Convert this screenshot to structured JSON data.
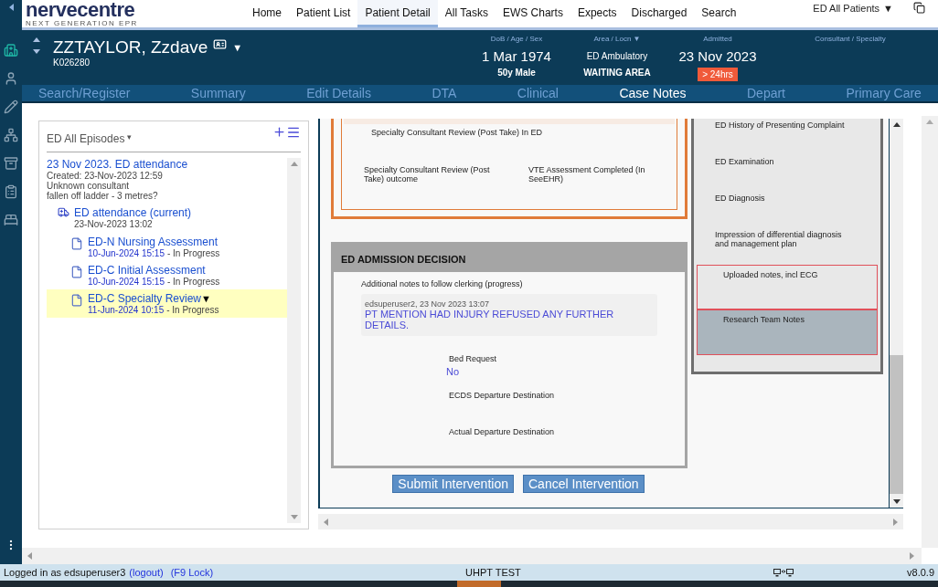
{
  "sidebar": {
    "items": [
      {
        "selected": true
      },
      {
        "selected": false
      },
      {
        "selected": false
      },
      {
        "selected": false
      },
      {
        "selected": false
      },
      {
        "selected": false
      },
      {
        "selected": false
      }
    ]
  },
  "logo": {
    "name": "nervecentre",
    "tagline": "NEXT GENERATION EPR"
  },
  "nav": [
    {
      "label": "Home",
      "selected": false
    },
    {
      "label": "Patient List",
      "selected": false
    },
    {
      "label": "Patient Detail",
      "selected": true
    },
    {
      "label": "All Tasks",
      "selected": false
    },
    {
      "label": "EWS Charts",
      "selected": false
    },
    {
      "label": "Expects",
      "selected": false
    },
    {
      "label": "Discharged",
      "selected": false
    },
    {
      "label": "Search",
      "selected": false
    }
  ],
  "patient_filter": {
    "label": "ED All Patients",
    "caret": "▼"
  },
  "patient": {
    "name": "ZZTAYLOR, Zzdave",
    "caret": "▼",
    "number": "K026280",
    "fields": [
      {
        "label": "DoB / Age / Sex",
        "value": "1 Mar 1974",
        "subvalue": "50y Male"
      },
      {
        "label": "Area / Locn",
        "caret": "▼",
        "value": "ED Ambulatory",
        "subvalue": "WAITING AREA"
      },
      {
        "label": "Admitted",
        "value": "23 Nov 2023",
        "badge": "> 24hrs"
      },
      {
        "label": "Consultant / Specialty"
      }
    ]
  },
  "tabs": [
    {
      "label": "Search/Register",
      "selected": false
    },
    {
      "label": "Summary",
      "selected": false
    },
    {
      "label": "Edit Details",
      "selected": false
    },
    {
      "label": "DTA",
      "selected": false
    },
    {
      "label": "Clinical",
      "selected": false
    },
    {
      "label": "Case Notes",
      "selected": true
    },
    {
      "label": "Depart",
      "selected": false
    },
    {
      "label": "Primary Care",
      "selected": false
    }
  ],
  "episodes": {
    "title": "ED All Episodes",
    "caret": "▾",
    "episode": {
      "title": "23 Nov 2023. ED attendance",
      "lines": [
        "Created: 23-Nov-2023 12:59",
        "Unknown consultant",
        "fallen off ladder - 3 metres?"
      ],
      "attendance": {
        "title": "ED attendance (current)",
        "date": "23-Nov-2023 13:02",
        "documents": [
          {
            "title": "ED-N Nursing Assessment",
            "date": "10-Jun-2024 15:15",
            "status": "- In Progress",
            "selected": false
          },
          {
            "title": "ED-C Initial Assessment",
            "date": "10-Jun-2024 15:15",
            "status": "- In Progress",
            "selected": false
          },
          {
            "title": "ED-C Specialty Review",
            "caret": "▼",
            "date": "11-Jun-2024 10:15",
            "status": "- In Progress",
            "selected": true
          }
        ]
      }
    }
  },
  "form": {
    "specialty_section": {
      "title": "Specialty Consultant Review (Post Take) In ED",
      "fields": [
        "Specialty Consultant Review (Post Take) outcome",
        "VTE Assessment Completed (In SeeEHR)"
      ]
    },
    "admission_decision": {
      "title": "ED ADMISSION DECISION",
      "notes_label": "Additional notes to follow clerking (progress)",
      "note": {
        "author": "edsuperuser2, 23 Nov 2023 13:07",
        "text": "PT MENTION HAD INJURY REFUSED ANY FURTHER DETAILS."
      },
      "fields": [
        {
          "label": "Bed Request",
          "value": "No"
        },
        {
          "label": "ECDS Departure Destination"
        },
        {
          "label": "Actual Departure Destination"
        }
      ]
    },
    "buttons": [
      "Submit Intervention",
      "Cancel Intervention"
    ],
    "sections": [
      {
        "label": "ED History of Presenting Complaint",
        "kind": "plain"
      },
      {
        "label": "ED Examination",
        "kind": "plain"
      },
      {
        "label": "ED Diagnosis",
        "kind": "plain"
      },
      {
        "label": "Impression of differential diagnosis and management plan",
        "kind": "plain"
      },
      {
        "label": "Uploaded notes, incl ECG",
        "kind": "flagged",
        "selected": false
      },
      {
        "label": "Research Team Notes",
        "kind": "flagged",
        "selected": true
      }
    ]
  },
  "status_bar": {
    "user_text": "Logged in as edsuperuser3",
    "logout": "(logout)",
    "lock": "(F9 Lock)",
    "environment": "UHPT TEST",
    "version": "v8.0.9"
  }
}
